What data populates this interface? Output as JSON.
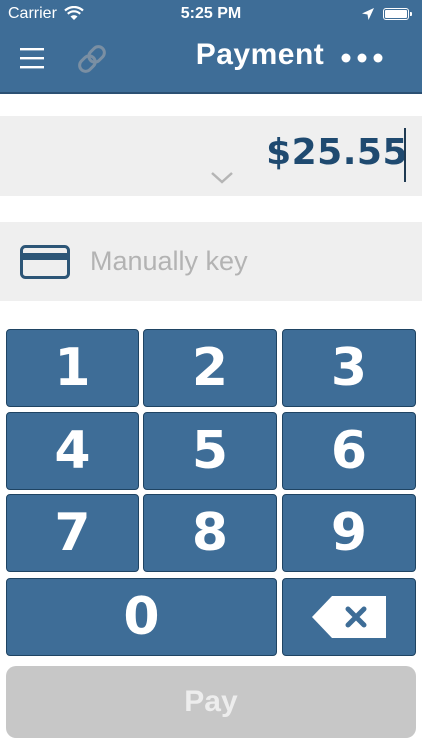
{
  "status_bar": {
    "carrier": "Carrier",
    "time": "5:25 PM",
    "wifi_icon": "wifi-icon",
    "location_icon": "location-arrow-icon",
    "battery_icon": "battery-icon"
  },
  "nav": {
    "title": "Payment",
    "menu_icon": "hamburger-menu-icon",
    "link_icon": "link-icon",
    "more_icon": "more-dots-icon"
  },
  "amount": {
    "value": "$25.55",
    "chevron_icon": "chevron-down-icon"
  },
  "manual_entry": {
    "label": "Manually key",
    "icon": "credit-card-icon"
  },
  "keypad": {
    "k1": "1",
    "k2": "2",
    "k3": "3",
    "k4": "4",
    "k5": "5",
    "k6": "6",
    "k7": "7",
    "k8": "8",
    "k9": "9",
    "k0": "0",
    "delete_icon": "backspace-icon"
  },
  "pay_button": {
    "label": "Pay",
    "state": "disabled"
  },
  "colors": {
    "primary": "#3e6d97",
    "amount_text": "#1f4a70",
    "panel_bg": "#efefef",
    "disabled_button": "#c7c7c7"
  }
}
